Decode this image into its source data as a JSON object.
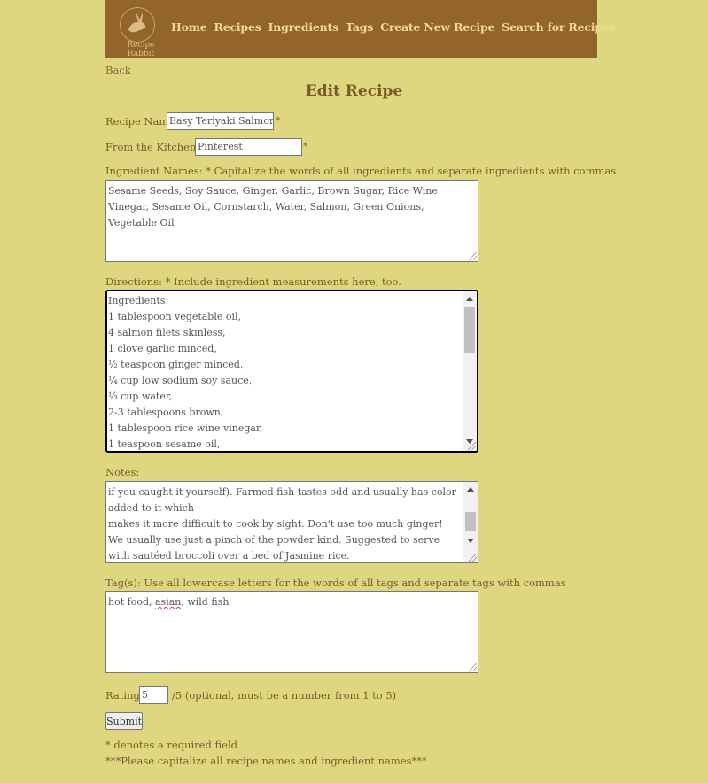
{
  "nav": {
    "logo_text": "Recipe Rabbit",
    "links": [
      "Home",
      "Recipes",
      "Ingredients",
      "Tags",
      "Create New Recipe",
      "Search for Recipes"
    ]
  },
  "back_link": "Back",
  "page_title": "Edit Recipe",
  "form": {
    "recipe_name": {
      "label": "Recipe Name:",
      "value": "Easy Teriyaki Salmon",
      "required_mark": "*"
    },
    "kitchen": {
      "label": "From the Kitchen of:",
      "value": "Pinterest",
      "required_mark": "*"
    },
    "ingredients": {
      "label": "Ingredient Names: * Capitalize the words of all ingredients and separate ingredients with commas",
      "value": "Sesame Seeds, Soy Sauce, Ginger, Garlic, Brown Sugar, Rice Wine Vinegar, Sesame Oil, Cornstarch, Water, Salmon, Green Onions, Vegetable Oil"
    },
    "directions": {
      "label": "Directions: * Include ingredient measurements here, too.",
      "lines": [
        "Ingredients:",
        "1 tablespoon vegetable oil,",
        "4 salmon filets skinless,",
        "1 clove garlic minced,",
        "½ teaspoon ginger minced,",
        "¼ cup low sodium soy sauce,",
        "⅓ cup water,",
        "2-3 tablespoons brown,",
        "1 tablespoon rice wine vinegar,",
        "1 teaspoon sesame oil,"
      ]
    },
    "notes": {
      "label": "Notes:",
      "lines": [
        "if you caught it yourself). Farmed fish tastes odd and usually has color added to it which",
        "makes it more difficult to cook by sight. Don't use too much ginger! We usually use just a pinch of the powder kind. Suggested to serve with sautéed broccoli over a bed of Jasmine rice."
      ]
    },
    "tags": {
      "label": "Tag(s): Use all lowercase letters for the words of all tags and separate tags with commas",
      "value_before": "hot food, ",
      "value_misspelled": "asian",
      "value_after": ", wild fish"
    },
    "rating": {
      "label": "Rating:",
      "value": "5",
      "suffix": "/5 (optional, must be a number from 1 to 5)"
    },
    "submit_label": "Submit"
  },
  "footer": {
    "required_note": "* denotes a required field",
    "capitalize_note": "***Please capitalize all recipe names and ingredient names***"
  },
  "colors": {
    "background": "#dfd77f",
    "navbar": "#93652d",
    "nav_link": "#f3d98e",
    "text": "#7b5a2a"
  }
}
